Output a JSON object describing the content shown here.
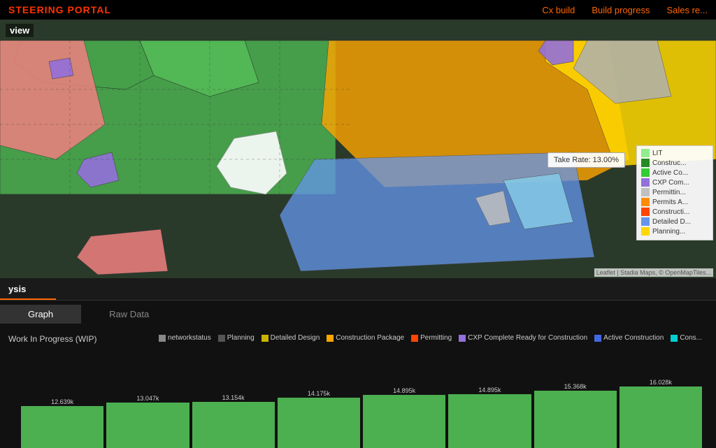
{
  "header": {
    "title": "STEERING PORTAL",
    "nav": [
      {
        "label": "Cx build",
        "key": "cx-build"
      },
      {
        "label": "Build progress",
        "key": "build-progress"
      },
      {
        "label": "Sales re...",
        "key": "sales-re"
      }
    ]
  },
  "map": {
    "section_label": "view",
    "tooltip": "Take Rate: 13.00%",
    "legend": [
      {
        "color": "#90EE90",
        "label": "LIT"
      },
      {
        "color": "#228B22",
        "label": "Construc..."
      },
      {
        "color": "#32CD32",
        "label": "Active Co..."
      },
      {
        "color": "#9370DB",
        "label": "CXP Com..."
      },
      {
        "color": "#C0C0C0",
        "label": "Permittin..."
      },
      {
        "color": "#FF8C00",
        "label": "Permits A..."
      },
      {
        "color": "#FF4500",
        "label": "Constructi..."
      },
      {
        "color": "#6495ED",
        "label": "Detailed D..."
      },
      {
        "color": "#FFD700",
        "label": "Planning..."
      }
    ],
    "attribution": "Leaflet | Stadia Maps, © OpenMapTiles..."
  },
  "analysis": {
    "title": "ysis",
    "tabs": [
      {
        "label": "Graph",
        "active": true
      },
      {
        "label": "Raw Data",
        "active": false
      }
    ],
    "wip_label": "Work In Progress (WIP)",
    "legend_items": [
      {
        "color": "#888",
        "label": "networkstatus"
      },
      {
        "color": "#4a4a4a",
        "label": "Planning"
      },
      {
        "color": "#c8b400",
        "label": "Detailed Design"
      },
      {
        "color": "#FFA500",
        "label": "Construction Package"
      },
      {
        "color": "#FF4500",
        "label": "Permitting"
      },
      {
        "color": "#9370DB",
        "label": "CXP Complete Ready for Construction"
      },
      {
        "color": "#4169E1",
        "label": "Active Construction"
      },
      {
        "color": "#00CED1",
        "label": "Cons..."
      }
    ],
    "bars": [
      {
        "value": "12.639k",
        "height": 60
      },
      {
        "value": "13.047k",
        "height": 65
      },
      {
        "value": "13.154k",
        "height": 66
      },
      {
        "value": "14.175k",
        "height": 72
      },
      {
        "value": "14.895k",
        "height": 76
      },
      {
        "value": "14.895k",
        "height": 77
      },
      {
        "value": "15.368k",
        "height": 82
      },
      {
        "value": "16.028k",
        "height": 88
      }
    ]
  }
}
